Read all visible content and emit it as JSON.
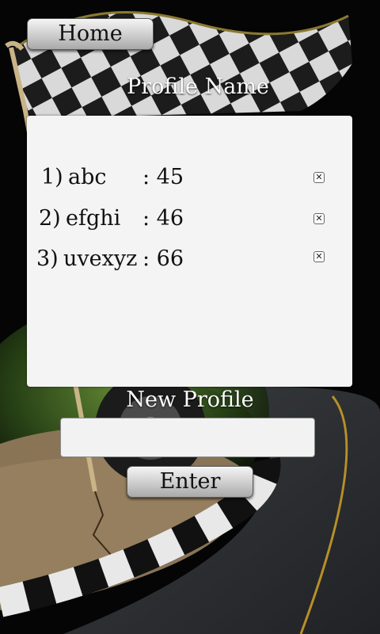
{
  "header": {
    "home_label": "Home",
    "profile_title": "Profile Name"
  },
  "profiles": [
    {
      "rank": "1)",
      "name": "abc",
      "score": ": 45"
    },
    {
      "rank": "2)",
      "name": "efghi",
      "score": ": 46"
    },
    {
      "rank": "3)",
      "name": "uvexyz",
      "score": ": 66"
    }
  ],
  "delete_icon": "close-x-icon",
  "new_profile": {
    "title": "New Profile",
    "value": "",
    "placeholder": "",
    "enter_label": "Enter"
  },
  "colors": {
    "panel": "#f4f4f4",
    "text_light": "#ffffff",
    "text_dark": "#111111"
  }
}
